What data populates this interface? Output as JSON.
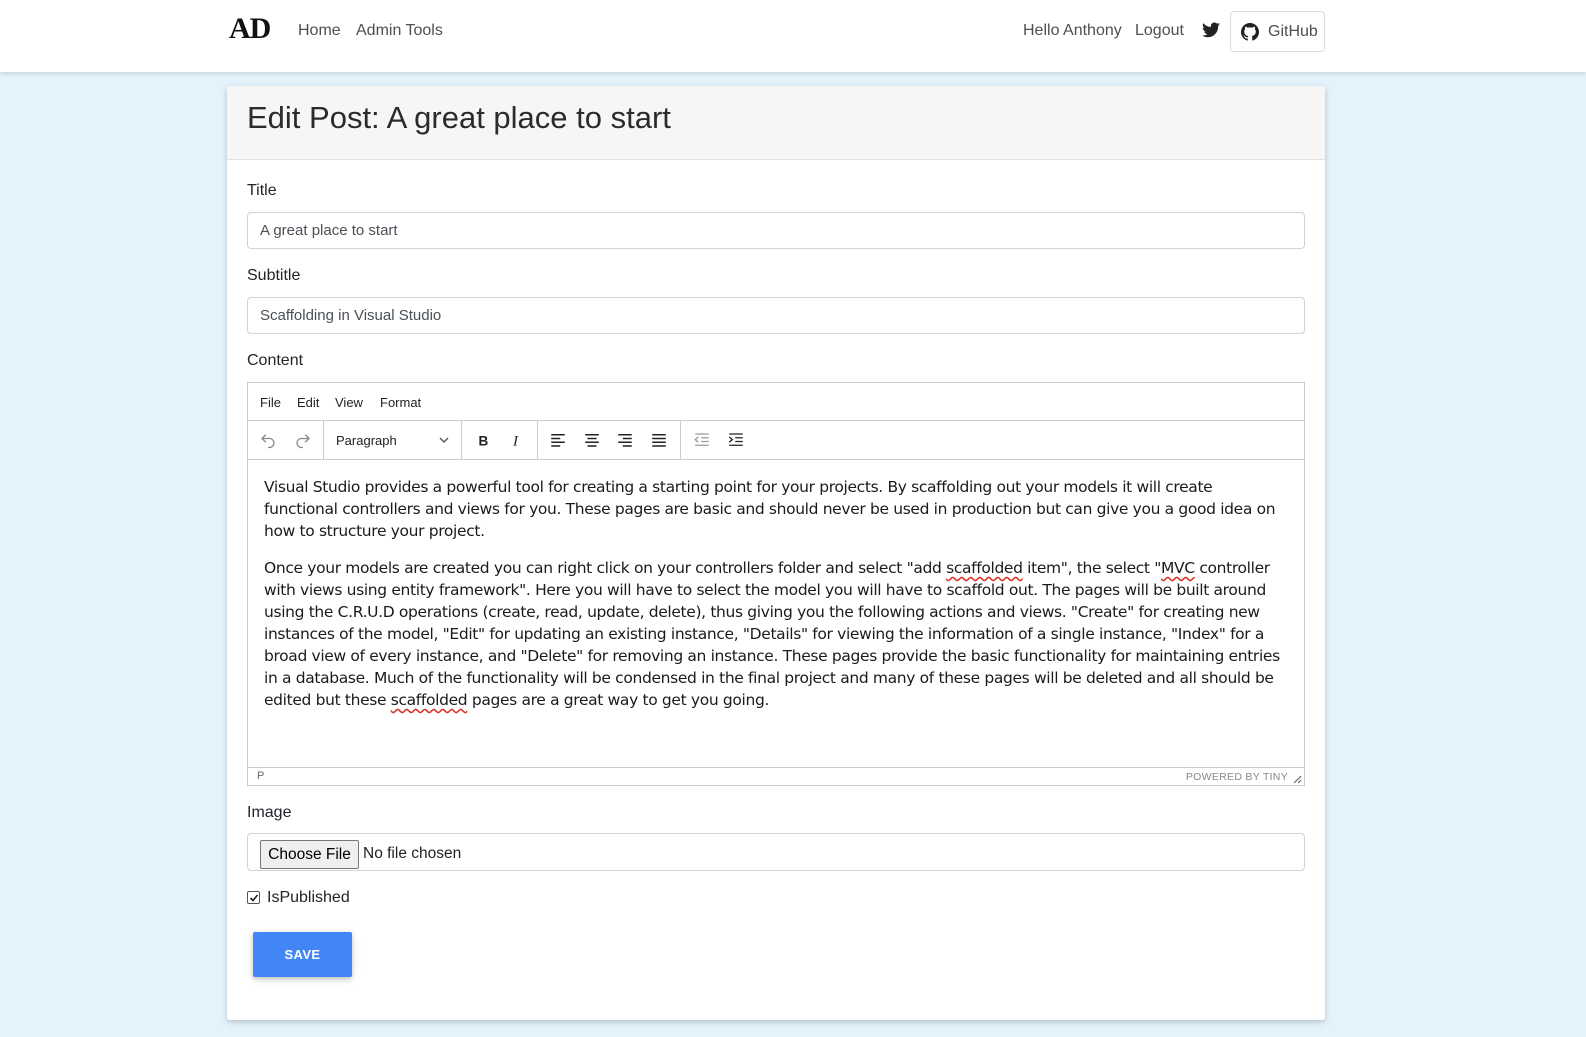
{
  "navbar": {
    "brand": "AD",
    "links": [
      "Home",
      "Admin Tools"
    ],
    "greeting": "Hello Anthony",
    "logout": "Logout",
    "twitter_icon": "twitter-icon",
    "github_label": "GitHub",
    "github_icon": "github-icon"
  },
  "page": {
    "title": "Edit Post: A great place to start"
  },
  "form": {
    "title_label": "Title",
    "title_value": "A great place to start",
    "subtitle_label": "Subtitle",
    "subtitle_value": "Scaffolding in Visual Studio",
    "content_label": "Content",
    "image_label": "Image",
    "choose_file": "Choose File",
    "file_status": "No file chosen",
    "is_published_label": "IsPublished",
    "is_published": true,
    "save": "SAVE"
  },
  "editor": {
    "menu": [
      "File",
      "Edit",
      "View",
      "Format"
    ],
    "block_format": "Paragraph",
    "toolbar_icons": [
      "undo-icon",
      "redo-icon",
      "bold-icon",
      "italic-icon",
      "align-left-icon",
      "align-center-icon",
      "align-right-icon",
      "align-justify-icon",
      "outdent-icon",
      "indent-icon"
    ],
    "status_path": "P",
    "powered_by": "POWERED BY TINY",
    "paragraph1": "Visual Studio provides a powerful tool for creating a starting point for your projects. By scaffolding out your models it will create functional controllers and views for you. These pages are basic and should never be used in production but can give you a good idea on how to structure your project.",
    "p2_a": "Once your models are created you can right click on your controllers folder and select \"add ",
    "p2_b": "scaffolded",
    "p2_c": " item\", the select \"",
    "p2_d": "MVC",
    "p2_e": " controller with views using entity framework\". Here you will have to select the model you will have to scaffold out. The pages will be built around using the C.R.U.D operations (create, read, update, delete), thus giving you the following actions and views. \"Create\" for creating new instances of the model, \"Edit\" for updating an existing instance, \"Details\" for viewing the information of a single instance, \"Index\" for a broad view of every instance, and \"Delete\" for removing an instance. These pages provide the basic functionality for maintaining entries in a database. Much of the functionality will be condensed in the final project and many of these pages will be deleted and all should be edited but these ",
    "p2_f": "scaffolded",
    "p2_g": " pages are a great way to get you going."
  },
  "colors": {
    "background": "#e4f2fc",
    "accent": "#4285f4"
  }
}
